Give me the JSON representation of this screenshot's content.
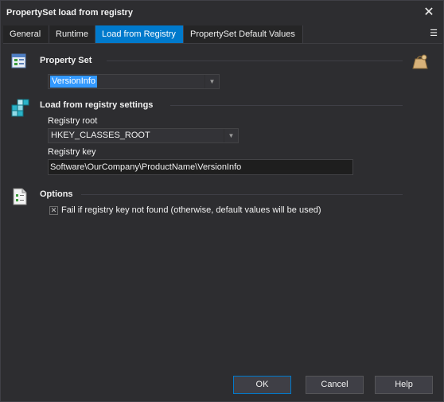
{
  "window": {
    "title": "PropertySet load from registry",
    "close_glyph": "✕"
  },
  "tabs": [
    {
      "label": "General"
    },
    {
      "label": "Runtime"
    },
    {
      "label": "Load from Registry",
      "active": true
    },
    {
      "label": "PropertySet Default Values"
    }
  ],
  "tab_menu_glyph": "☰",
  "property_set": {
    "heading": "Property Set",
    "selected_value": "VersionInfo"
  },
  "registry_settings": {
    "heading": "Load from registry settings",
    "root_label": "Registry root",
    "root_value": "HKEY_CLASSES_ROOT",
    "key_label": "Registry key",
    "key_value": "Software\\OurCompany\\ProductName\\VersionInfo"
  },
  "options": {
    "heading": "Options",
    "fail_label": "Fail if registry key not found (otherwise, default values will be used)",
    "fail_checked": true,
    "check_glyph": "✕"
  },
  "buttons": {
    "ok": "OK",
    "cancel": "Cancel",
    "help": "Help"
  },
  "colors": {
    "background": "#2d2d30",
    "accent": "#007acc",
    "selection": "#3399ff"
  },
  "icons": [
    "property-set-icon",
    "registry-cube-icon",
    "options-checklist-icon",
    "variables-bag-icon",
    "dropdown-arrow-icon"
  ]
}
